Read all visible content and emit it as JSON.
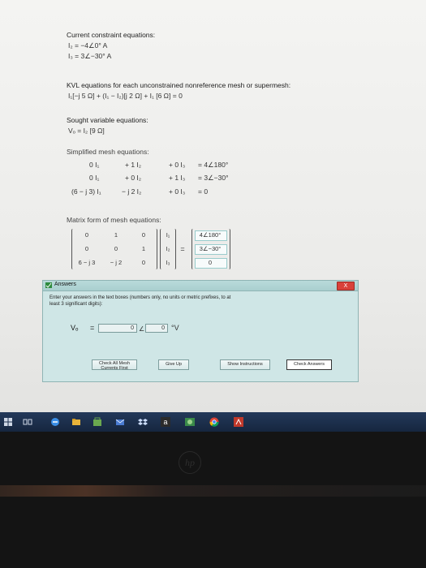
{
  "constraint": {
    "heading": "Current constraint equations:",
    "eq1": "I₂ = −4∠0° A",
    "eq2": "I₃ = 3∠−30° A"
  },
  "kvl": {
    "heading": "KVL equations for each unconstrained nonreference mesh or supermesh:",
    "eq": "I₁[−j 5 Ω] + (I₁ − I₂)[j 2 Ω] + I₁ [6 Ω] = 0"
  },
  "sought": {
    "heading": "Sought variable equations:",
    "eq": "Vₒ = I₂ [9 Ω]"
  },
  "simplified": {
    "heading": "Simplified mesh equations:",
    "rows": [
      {
        "c1": "0 I₁",
        "c2": "+ 1 I₂",
        "c3": "+ 0 I₃",
        "rhs": "=  4∠180°"
      },
      {
        "c1": "0 I₁",
        "c2": "+ 0 I₂",
        "c3": "+ 1 I₃",
        "rhs": "=  3∠−30°"
      },
      {
        "c1": "(6 − j 3) I₁",
        "c2": "− j 2 I₂",
        "c3": "+ 0 I₃",
        "rhs": "=  0"
      }
    ]
  },
  "matrix": {
    "heading": "Matrix form of mesh equations:",
    "coeffs": [
      [
        "0",
        "1",
        "0"
      ],
      [
        "0",
        "0",
        "1"
      ],
      [
        "6 − j 3",
        "− j 2",
        "0"
      ]
    ],
    "vars": [
      "I₁",
      "I₂",
      "I₃"
    ],
    "eq_sign": "=",
    "rhs": [
      "4∠180°",
      "3∠−30°",
      "0"
    ]
  },
  "dialog": {
    "title": "Answers",
    "close_label": "X",
    "instructions": "Enter your answers in the text boxes (numbers only, no units or metric prefixes, to at least 3 significant digits):",
    "vo_label": "Vₒ",
    "eq_sign": "=",
    "magnitude_value": "0",
    "angle_symbol": "∠",
    "angle_value": "0",
    "unit": "°V",
    "buttons": {
      "check_mesh": "Check All Mesh Currents First",
      "give_up": "Give Up",
      "show_instructions": "Show Instructions",
      "check_answers": "Check Answers"
    }
  },
  "taskbar": {
    "icons": [
      "windows-icon",
      "task-view-icon",
      "edge-icon",
      "file-explorer-icon",
      "store-icon",
      "mail-icon",
      "dropbox-icon",
      "amazon-icon",
      "photos-icon",
      "chrome-icon",
      "acrobat-icon"
    ]
  },
  "bezel": {
    "logo": "hp"
  }
}
